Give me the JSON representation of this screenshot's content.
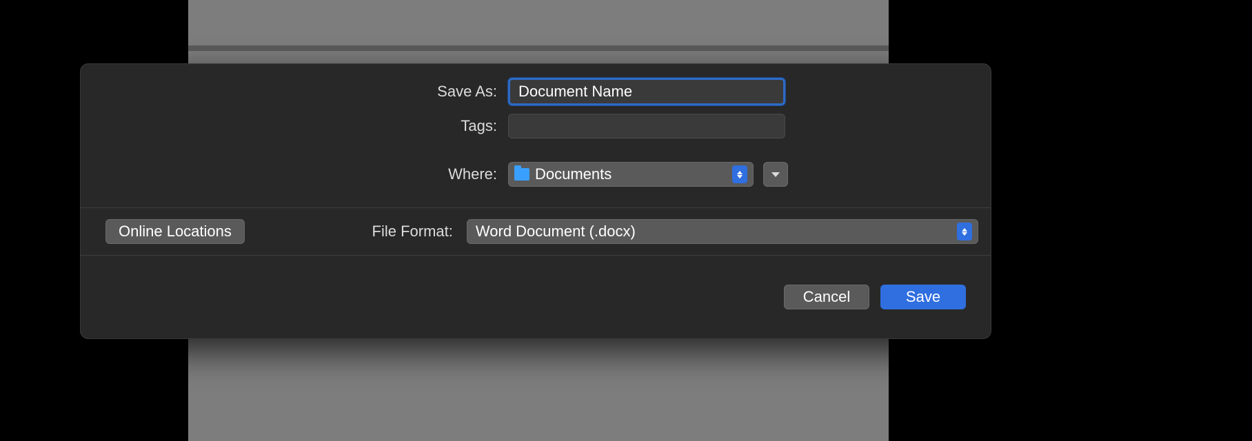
{
  "dialog": {
    "save_as_label": "Save As:",
    "save_as_value": "Document Name",
    "tags_label": "Tags:",
    "tags_value": "",
    "where_label": "Where:",
    "where_value": "Documents",
    "online_locations_label": "Online Locations",
    "file_format_label": "File Format:",
    "file_format_value": "Word Document (.docx)",
    "cancel_label": "Cancel",
    "save_label": "Save"
  }
}
